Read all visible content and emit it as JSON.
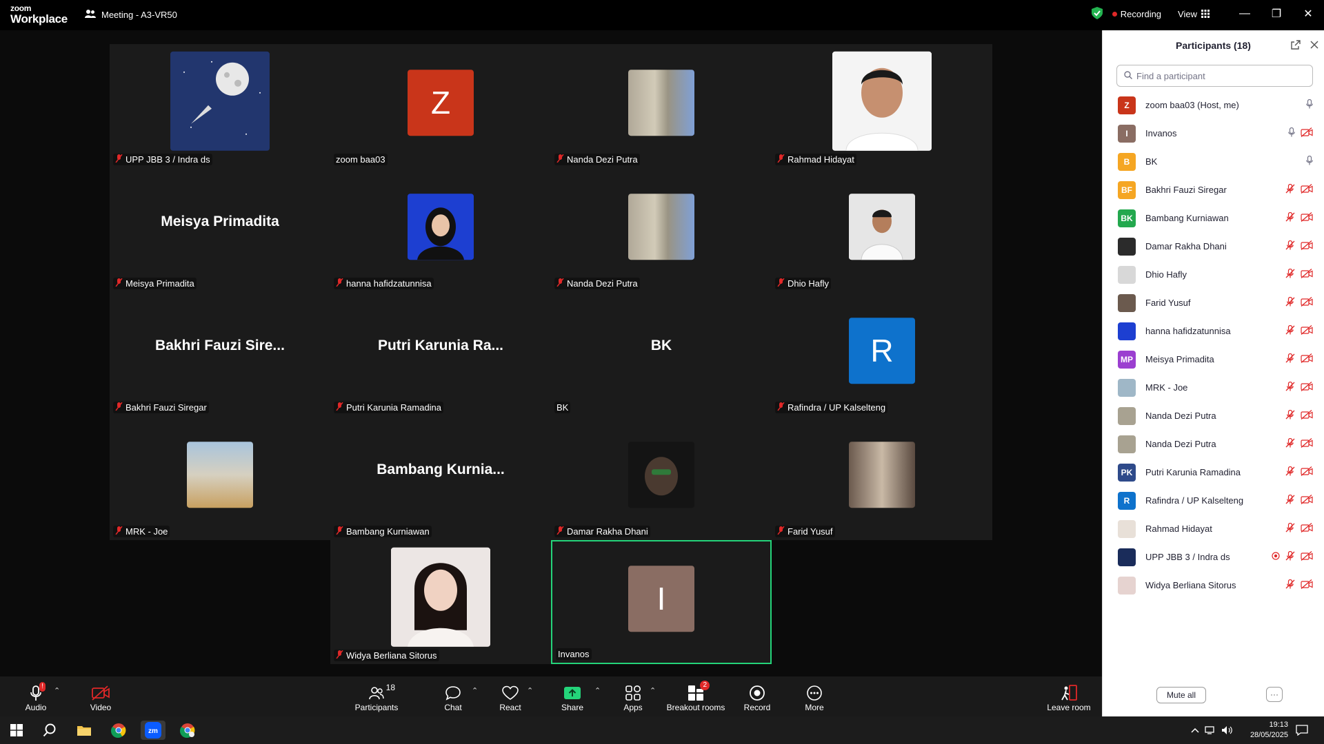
{
  "app": {
    "logo_line1": "zoom",
    "logo_line2": "Workplace",
    "meeting_title": "Meeting - A3-VR50",
    "recording_label": "Recording",
    "view_label": "View"
  },
  "tiles": [
    {
      "name": "UPP JBB 3 / Indra ds",
      "muted": true,
      "avatar": "moon-rocket-photo"
    },
    {
      "name": "zoom baa03",
      "muted": false,
      "avatar_letter": "Z",
      "avatar_color": "#c9351a"
    },
    {
      "name": "Nanda Dezi Putra",
      "muted": true,
      "avatar": "landscape-photo"
    },
    {
      "name": "Rahmad Hidayat",
      "muted": true,
      "avatar": "portrait-photo"
    },
    {
      "name": "Meisya Primadita",
      "muted": true,
      "display": "Meisya Primadita"
    },
    {
      "name": "hanna hafidzatunnisa",
      "muted": true,
      "avatar": "hijab-portrait-photo"
    },
    {
      "name": "Nanda Dezi Putra",
      "muted": true,
      "avatar": "landscape-photo"
    },
    {
      "name": "Dhio Hafly",
      "muted": true,
      "avatar": "portrait-photo"
    },
    {
      "name": "Bakhri Fauzi Siregar",
      "muted": true,
      "display": "Bakhri Fauzi Sire..."
    },
    {
      "name": "Putri Karunia Ramadina",
      "muted": true,
      "display": "Putri Karunia Ra..."
    },
    {
      "name": "BK",
      "muted": false,
      "display": "BK"
    },
    {
      "name": "Rafindra / UP Kalselteng",
      "muted": true,
      "avatar_letter": "R",
      "avatar_color": "#0e72cc"
    },
    {
      "name": "MRK - Joe",
      "muted": true,
      "avatar": "beach-photo"
    },
    {
      "name": "Bambang Kurniawan",
      "muted": true,
      "display": "Bambang  Kurnia..."
    },
    {
      "name": "Damar Rakha Dhani",
      "muted": true,
      "avatar": "dark-photo"
    },
    {
      "name": "Farid Yusuf",
      "muted": true,
      "avatar": "room-photo"
    },
    {
      "name": "Widya Berliana Sitorus",
      "muted": true,
      "avatar": "portrait-photo"
    },
    {
      "name": "Invanos",
      "muted": false,
      "avatar_letter": "I",
      "avatar_color": "#8a6d63"
    }
  ],
  "toolbar": {
    "audio": "Audio",
    "video": "Video",
    "participants": "Participants",
    "participants_count": "18",
    "chat": "Chat",
    "react": "React",
    "share": "Share",
    "apps": "Apps",
    "breakout": "Breakout rooms",
    "breakout_badge": "2",
    "record": "Record",
    "more": "More",
    "leave": "Leave room"
  },
  "panel": {
    "title": "Participants (18)",
    "search_placeholder": "Find a participant",
    "mute_all": "Mute all",
    "more": "···",
    "participants": [
      {
        "name": "zoom baa03 (Host, me)",
        "initials": "Z",
        "color": "#c9351a",
        "mic": "on",
        "video": "none"
      },
      {
        "name": "Invanos",
        "initials": "I",
        "color": "#8a6d63",
        "mic": "on",
        "video": "off"
      },
      {
        "name": "BK",
        "initials": "B",
        "color": "#f5a623",
        "mic": "on",
        "video": "none"
      },
      {
        "name": "Bakhri Fauzi Siregar",
        "initials": "BF",
        "color": "#f5a623",
        "mic": "off",
        "video": "off"
      },
      {
        "name": "Bambang Kurniawan",
        "initials": "BK",
        "color": "#23a84e",
        "mic": "off",
        "video": "off"
      },
      {
        "name": "Damar Rakha Dhani",
        "initials": "",
        "color": "#2b2b2b",
        "mic": "off",
        "video": "off"
      },
      {
        "name": "Dhio Hafly",
        "initials": "",
        "color": "#d8d8d8",
        "mic": "off",
        "video": "off"
      },
      {
        "name": "Farid Yusuf",
        "initials": "",
        "color": "#6b5a4e",
        "mic": "off",
        "video": "off"
      },
      {
        "name": "hanna hafidzatunnisa",
        "initials": "",
        "color": "#1d3fd1",
        "mic": "off",
        "video": "off"
      },
      {
        "name": "Meisya Primadita",
        "initials": "MP",
        "color": "#9b3fd0",
        "mic": "off",
        "video": "off"
      },
      {
        "name": "MRK - Joe",
        "initials": "",
        "color": "#9fb7c7",
        "mic": "off",
        "video": "off"
      },
      {
        "name": "Nanda Dezi Putra",
        "initials": "",
        "color": "#a8a291",
        "mic": "off",
        "video": "off"
      },
      {
        "name": "Nanda Dezi Putra",
        "initials": "",
        "color": "#a8a291",
        "mic": "off",
        "video": "off"
      },
      {
        "name": "Putri Karunia Ramadina",
        "initials": "PK",
        "color": "#2e4a8a",
        "mic": "off",
        "video": "off"
      },
      {
        "name": "Rafindra / UP Kalselteng",
        "initials": "R",
        "color": "#0e72cc",
        "mic": "off",
        "video": "off"
      },
      {
        "name": "Rahmad Hidayat",
        "initials": "",
        "color": "#e8e0d8",
        "mic": "off",
        "video": "off"
      },
      {
        "name": "UPP JBB 3 / Indra ds",
        "initials": "",
        "color": "#1a2c5a",
        "mic": "off",
        "video": "off",
        "recording": true
      },
      {
        "name": "Widya Berliana Sitorus",
        "initials": "",
        "color": "#e6d3d0",
        "mic": "off",
        "video": "off"
      }
    ]
  },
  "taskbar": {
    "time": "19:13",
    "date": "28/05/2025"
  },
  "colors": {
    "mute_red": "#e02828",
    "active_speaker": "#24d47a",
    "share_green": "#24d47a",
    "panel_bg": "#ffffff"
  }
}
